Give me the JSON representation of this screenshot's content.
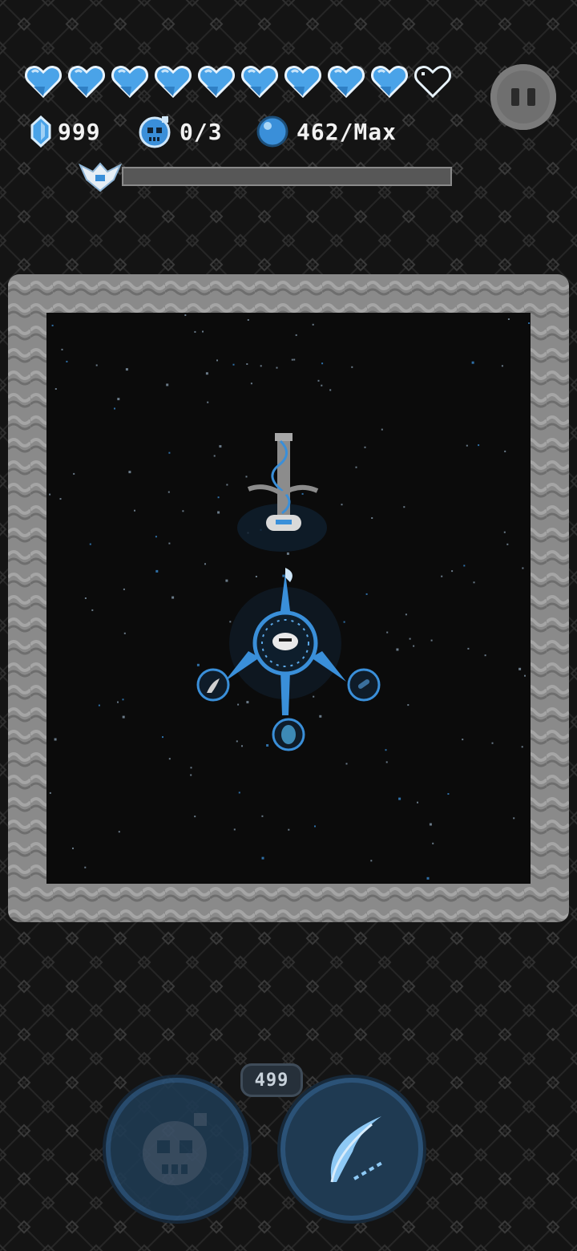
{
  "hud": {
    "hearts": {
      "filled": 9,
      "total": 10
    },
    "gems": "999",
    "bombs": "0/3",
    "souls": "462/Max",
    "boss_progress": 0.0
  },
  "abilities": {
    "bomb_icon": "skull-bomb-icon",
    "slash_icon": "feather-slash-icon",
    "slash_cost": "499"
  },
  "colors": {
    "accent_blue": "#3a8fd9",
    "heart_blue": "#4aa3e8",
    "stone": "#8c8c8c",
    "space": "#0b0b0b"
  }
}
